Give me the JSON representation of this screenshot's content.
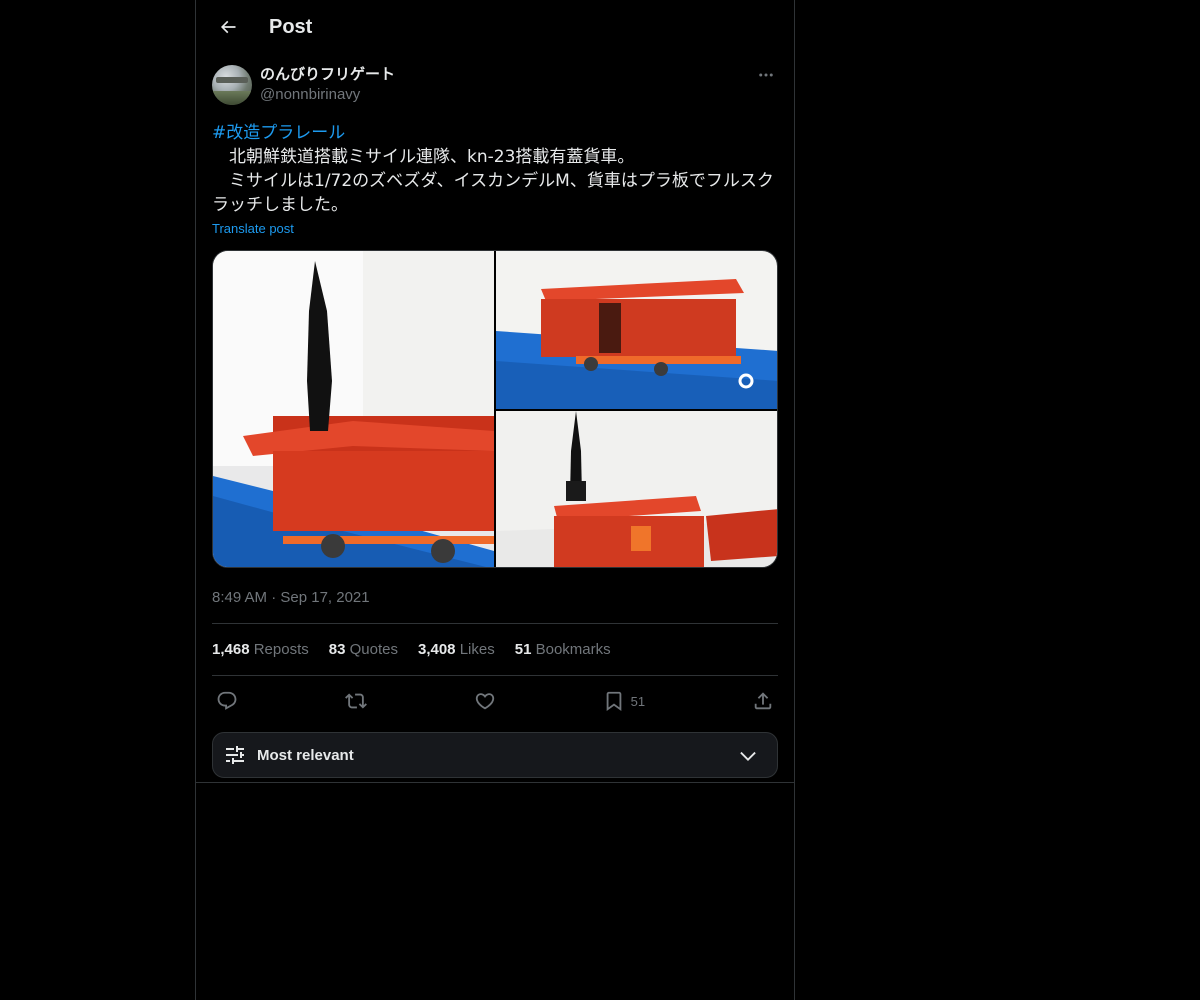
{
  "header": {
    "title": "Post"
  },
  "author": {
    "display_name": "のんびりフリゲート",
    "handle": "@nonnbirinavy"
  },
  "post": {
    "hashtag": "#改造プラレール",
    "line1": "　北朝鮮鉄道搭載ミサイル連隊、kn-23搭載有蓋貨車。",
    "line2": "　ミサイルは1/72のズベズダ、イスカンデルM、貨車はプラ板でフルスクラッチしました。",
    "translate_label": "Translate post",
    "timestamp": "8:49 AM · Sep 17, 2021"
  },
  "stats": [
    {
      "num": "1,468",
      "label": "Reposts"
    },
    {
      "num": "83",
      "label": "Quotes"
    },
    {
      "num": "3,408",
      "label": "Likes"
    },
    {
      "num": "51",
      "label": "Bookmarks"
    }
  ],
  "actions": {
    "bookmark_count": "51"
  },
  "sort": {
    "label": "Most relevant"
  },
  "colors": {
    "accent": "#1d9bf0",
    "secondary_text": "#71767b",
    "border": "#2f3336"
  }
}
